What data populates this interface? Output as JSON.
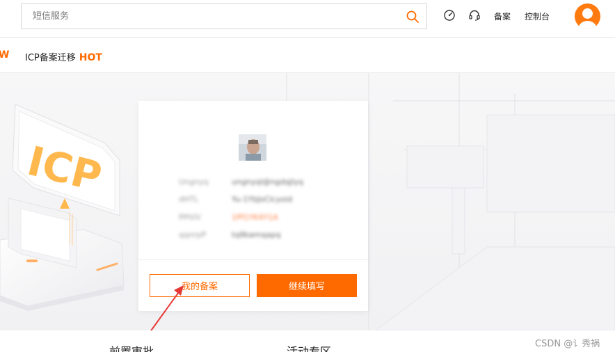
{
  "search": {
    "placeholder": "短信服务"
  },
  "header": {
    "links": {
      "beian": "备案",
      "console": "控制台"
    },
    "icons": [
      "dashboard-icon",
      "headset-icon",
      "search-icon",
      "user-avatar-icon"
    ]
  },
  "subnav": {
    "partial_item": "W",
    "items": [
      {
        "label": "ICP备案迁移",
        "badge": "HOT"
      }
    ]
  },
  "hero": {
    "illustration_text": "ICP"
  },
  "card": {
    "rows": [
      {
        "key": "Ungnyq",
        "value": "ungnyql@ngdqjlyq"
      },
      {
        "key": "dHTL",
        "value": "Yu-1YbJoClcyoid"
      },
      {
        "key": "PPIVV",
        "value": "1Pf1YK4Y1A"
      },
      {
        "key": "qqnrpP",
        "value": "tq9bamqapq"
      }
    ],
    "buttons": {
      "my_filing": "我的备案",
      "continue": "继续填写"
    }
  },
  "bottom": {
    "tabs": [
      "前置审批",
      "活动专区"
    ],
    "watermark": "CSDN @讠秀祸"
  },
  "colors": {
    "accent": "#ff6a00",
    "annotation_arrow": "#e53935"
  }
}
